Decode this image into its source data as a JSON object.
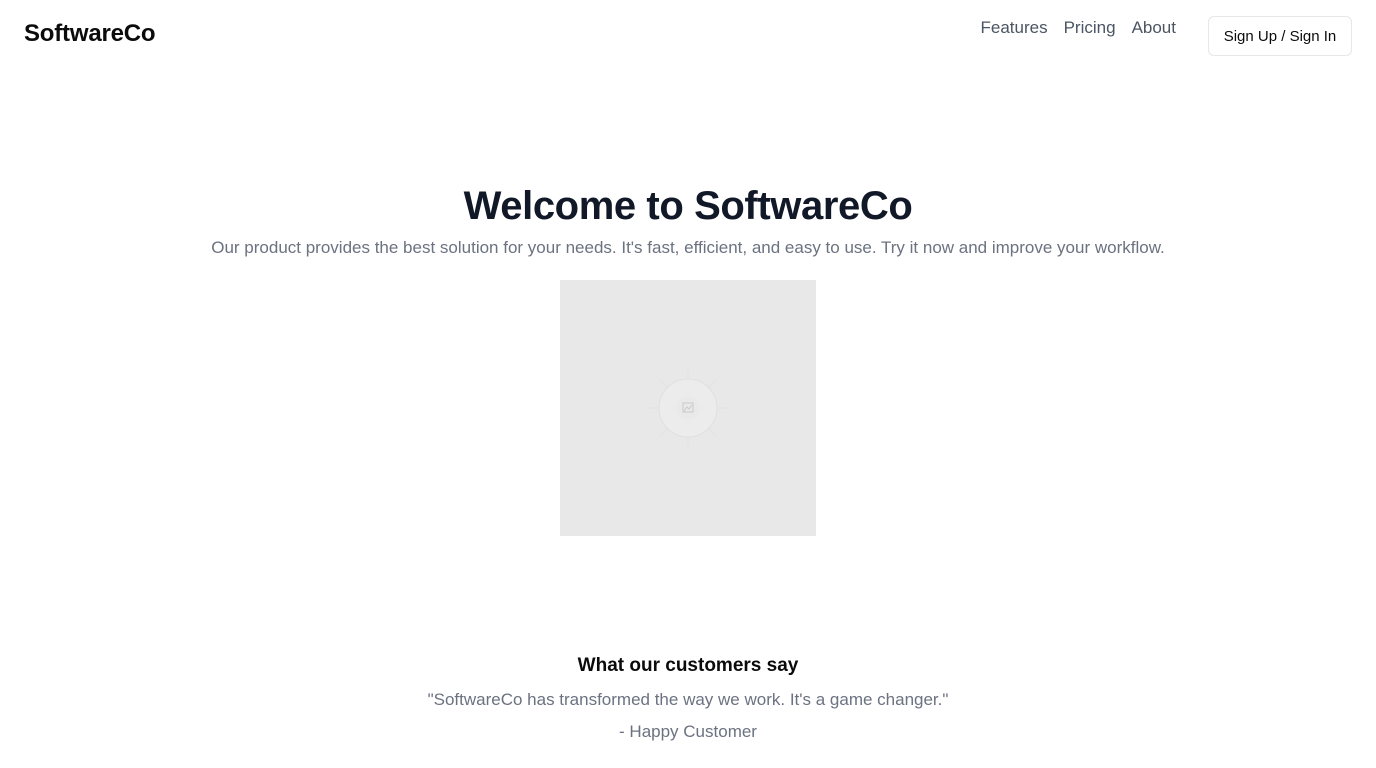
{
  "header": {
    "brand": "SoftwareCo",
    "nav": [
      "Features",
      "Pricing",
      "About"
    ],
    "auth_label": "Sign Up / Sign In"
  },
  "hero": {
    "title": "Welcome to SoftwareCo",
    "subtitle": "Our product provides the best solution for your needs. It's fast, efficient, and easy to use. Try it now and improve your workflow.",
    "image_icon": "image-placeholder-icon"
  },
  "testimonials": {
    "title": "What our customers say",
    "quote": "\"SoftwareCo has transformed the way we work. It's a game changer.\"",
    "author": "- Happy Customer"
  },
  "colors": {
    "text_primary": "#111827",
    "text_muted": "#6b7280",
    "nav_text": "#4b5563",
    "image_bg": "#e8e8e8",
    "border": "#e5e7eb"
  }
}
